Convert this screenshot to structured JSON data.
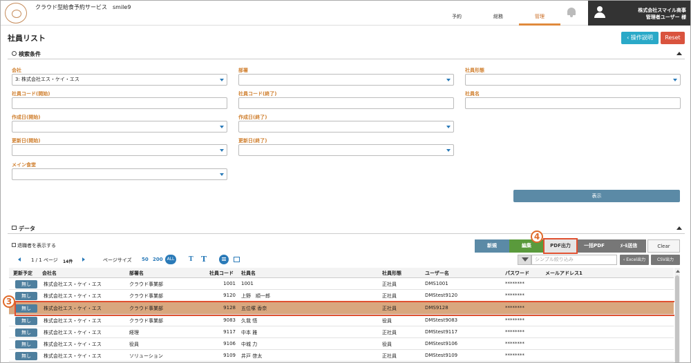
{
  "header": {
    "app_title": "クラウド型給食予約サービス　smile9",
    "nav": [
      "予約",
      "総務",
      "管理"
    ],
    "active_nav": "管理",
    "user_company": "株式会社スマイル商事",
    "user_role": "管理者ユーザー 様"
  },
  "page": {
    "title": "社員リスト",
    "help_label": "‹ 操作説明",
    "reset_label": "Reset"
  },
  "search": {
    "section_title": "検索条件",
    "labels": {
      "company": "会社",
      "department": "部署",
      "employment_type": "社員形態",
      "code_start": "社員コード(開始)",
      "code_end": "社員コード(終了)",
      "employee_name": "社員名",
      "created_start": "作成日(開始)",
      "created_end": "作成日(終了)",
      "updated_start": "更新日(開始)",
      "updated_end": "更新日(終了)",
      "main_cafeteria": "メイン食堂"
    },
    "values": {
      "company": "3: 株式会社エス・ケイ・エス"
    },
    "show_button": "表示"
  },
  "data": {
    "section_title": "データ",
    "show_retired": "退職者を表示する",
    "buttons": {
      "new": "新規",
      "edit": "編集",
      "pdf": "PDF出力",
      "bulk_pdf": "一括PDF",
      "mail": "ﾒｰﾙ送信",
      "clear": "Clear",
      "excel": "‹ Excel出力",
      "csv": "CSV出力"
    },
    "pager": {
      "page_text": "1 / 1 ページ",
      "count": "14件",
      "size_label": "ページサイズ",
      "sizes": [
        "50",
        "200",
        "ALL"
      ]
    },
    "font_small": "T",
    "font_large": "T",
    "filter_placeholder": "シンプル絞り込み",
    "columns": [
      "更新予定",
      "会社名",
      "部署名",
      "社員コード",
      "社員名",
      "社員形態",
      "ユーザー名",
      "パスワード",
      "メールアドレス1"
    ],
    "rows": [
      {
        "flag": "無し",
        "company": "株式会社エス・ケイ・エス",
        "dept": "クラウド事業部",
        "code": "1001",
        "name": "1001",
        "type": "正社員",
        "user": "DMS1001",
        "password": "********",
        "email": ""
      },
      {
        "flag": "無し",
        "company": "株式会社エス・ケイ・エス",
        "dept": "クラウド事業部",
        "code": "9120",
        "name": "上野　順一郎",
        "type": "正社員",
        "user": "DMStest9120",
        "password": "********",
        "email": ""
      },
      {
        "flag": "無し",
        "company": "株式会社エス・ケイ・エス",
        "dept": "クラウド事業部",
        "code": "9128",
        "name": "五位塚 香奈",
        "type": "正社員",
        "user": "DMS9128",
        "password": "********",
        "email": ""
      },
      {
        "flag": "無し",
        "company": "株式会社エス・ケイ・エス",
        "dept": "クラウド事業部",
        "code": "9083",
        "name": "久我 悟",
        "type": "役員",
        "user": "DMStest9083",
        "password": "********",
        "email": ""
      },
      {
        "flag": "無し",
        "company": "株式会社エス・ケイ・エス",
        "dept": "経理",
        "code": "9117",
        "name": "中本 雅",
        "type": "正社員",
        "user": "DMStest9117",
        "password": "********",
        "email": ""
      },
      {
        "flag": "無し",
        "company": "株式会社エス・ケイ・エス",
        "dept": "役員",
        "code": "9106",
        "name": "中城 力",
        "type": "役員",
        "user": "DMStest9106",
        "password": "********",
        "email": ""
      },
      {
        "flag": "無し",
        "company": "株式会社エス・ケイ・エス",
        "dept": "ソリューション",
        "code": "9109",
        "name": "井戸 啓太",
        "type": "正社員",
        "user": "DMStest9109",
        "password": "********",
        "email": ""
      }
    ]
  },
  "callouts": [
    "3",
    "4"
  ],
  "colors": {
    "accent": "#d08030",
    "highlight_row": "#d9a77e",
    "callout": "#e06a2a"
  }
}
